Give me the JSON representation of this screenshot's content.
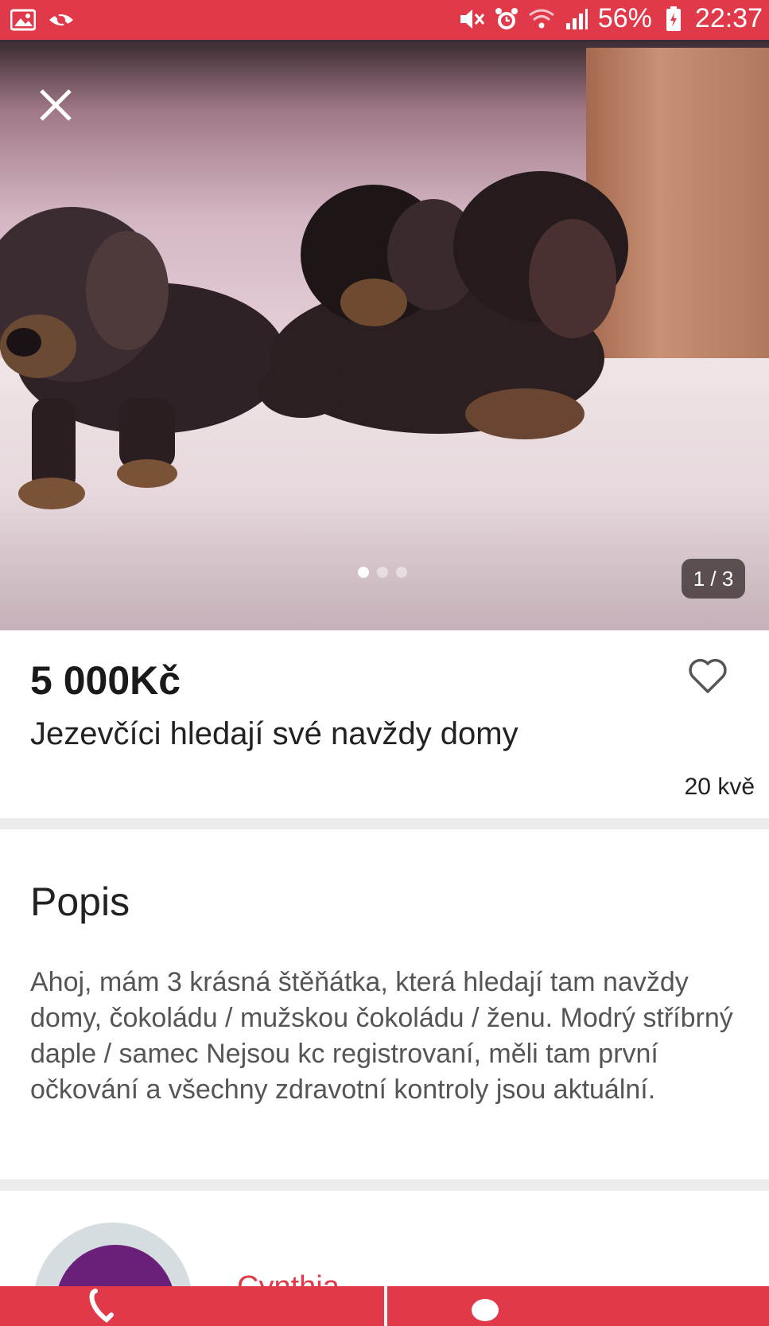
{
  "status_bar": {
    "battery_percent": "56%",
    "time": "22:37",
    "icons": [
      "gallery-icon",
      "eye-off-icon",
      "mute-icon",
      "alarm-icon",
      "wifi-icon",
      "signal-icon",
      "battery-icon"
    ]
  },
  "gallery": {
    "counter": "1 / 3",
    "current_index": 1,
    "total": 3
  },
  "listing": {
    "price": "5 000Kč",
    "title": "Jezevčíci hledají své navždy domy",
    "date": "20 kvě"
  },
  "description": {
    "heading": "Popis",
    "text": "Ahoj, mám 3 krásná štěňátka, která hledají tam navždy domy, čokoládu / mužskou čokoládu / ženu. Modrý stříbrný daple / samec Nejsou kc registrovaní, měli tam první očkování a všechny zdravotní kontroly jsou aktuální."
  },
  "seller": {
    "name": "Cynthia"
  },
  "colors": {
    "accent": "#e0394a",
    "background": "#ffffff",
    "separator": "#ebebeb"
  }
}
